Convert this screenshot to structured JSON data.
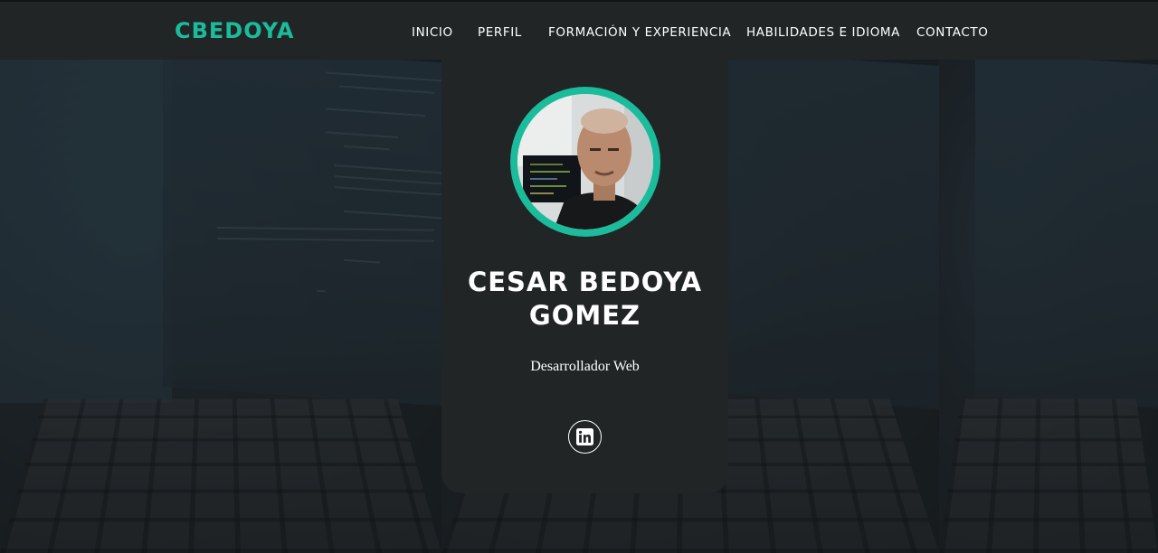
{
  "brand": {
    "logo": "CBEDOYA"
  },
  "nav": {
    "items": [
      {
        "label": "INICIO"
      },
      {
        "label": "PERFIL"
      },
      {
        "label": "FORMACIÓN Y EXPERIENCIA"
      },
      {
        "label": "HABILIDADES E IDIOMA"
      },
      {
        "label": "CONTACTO"
      }
    ]
  },
  "profile": {
    "name_line1": "CESAR BEDOYA",
    "name_line2": "GOMEZ",
    "role": "Desarrollador Web",
    "social": [
      {
        "icon": "linkedin-icon"
      }
    ]
  },
  "colors": {
    "accent": "#1abc9c",
    "navbar": "#212526",
    "card": "#212526",
    "text": "#ffffff"
  }
}
